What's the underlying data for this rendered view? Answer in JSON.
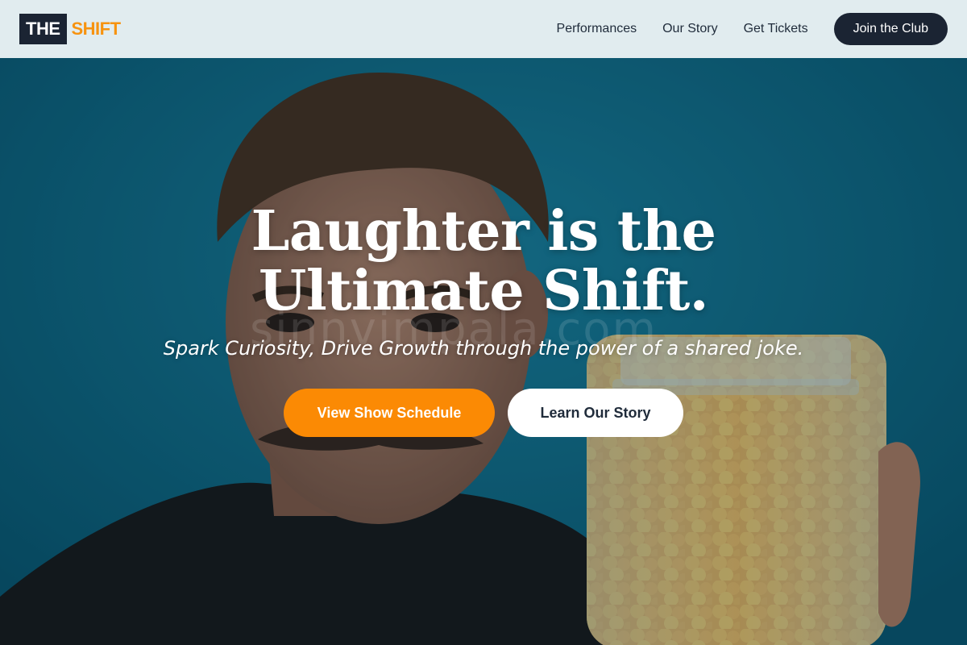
{
  "logo": {
    "part1": "THE",
    "part2": "SHIFT"
  },
  "nav": {
    "links": [
      "Performances",
      "Our Story",
      "Get Tickets"
    ],
    "cta": "Join the Club"
  },
  "hero": {
    "title": "Laughter is the Ultimate Shift.",
    "subtitle": "Spark Curiosity, Drive Growth through the power of a shared joke.",
    "primary_button": "View Show Schedule",
    "secondary_button": "Learn Our Story"
  },
  "watermark": "sinnvimpala.com",
  "colors": {
    "accent": "#fb8a04",
    "dark": "#1b2433",
    "hero_bg": "#0d6e8e"
  }
}
